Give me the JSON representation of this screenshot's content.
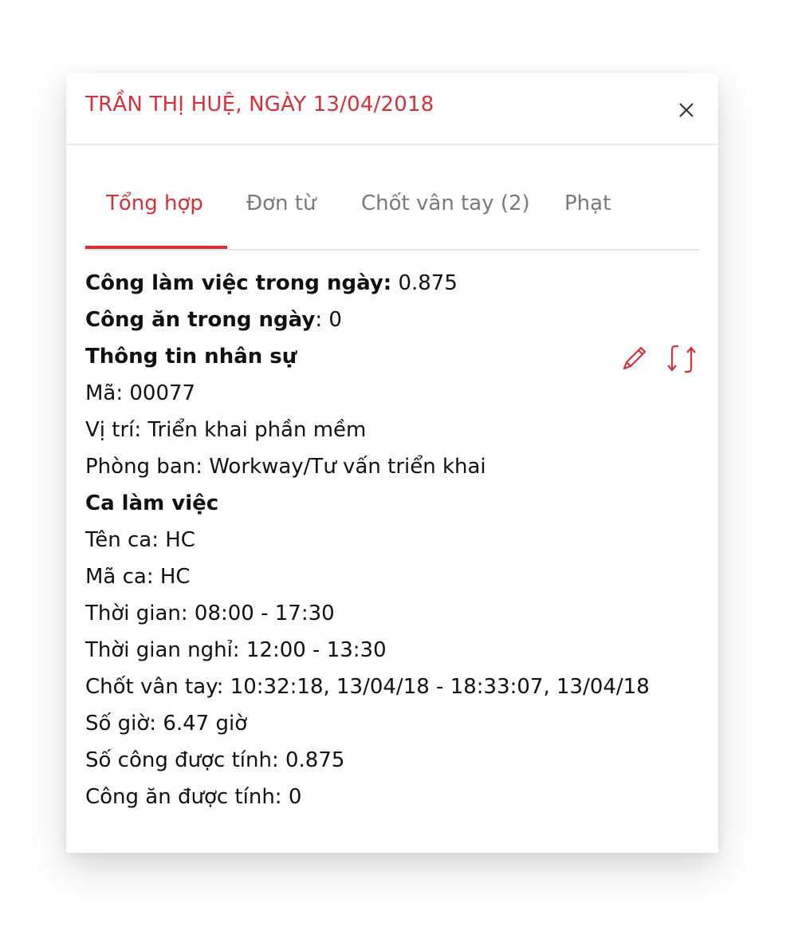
{
  "modal": {
    "title": "TRẦN THỊ HUỆ, NGÀY 13/04/2018"
  },
  "tabs": [
    {
      "label": "Tổng hợp",
      "active": true
    },
    {
      "label": "Đơn từ",
      "active": false
    },
    {
      "label": "Chốt vân tay (2)",
      "active": false
    },
    {
      "label": "Phạt",
      "active": false
    }
  ],
  "summary": {
    "work_label": "Công làm việc trong ngày:",
    "work_value": " 0.875",
    "meal_label": "Công ăn trong ngày",
    "meal_value": ": 0"
  },
  "employee": {
    "heading": "Thông tin nhân sự",
    "code": "Mã: 00077",
    "position": "Vị trí: Triển khai phần mềm",
    "department": "Phòng ban: Workway/Tư vấn triển khai"
  },
  "shift": {
    "heading": "Ca làm việc",
    "name": "Tên ca: HC",
    "code": "Mã ca: HC",
    "time": "Thời gian: 08:00 - 17:30",
    "break_time": "Thời gian nghỉ: 12:00 - 13:30",
    "fingerprint": "Chốt vân tay: 10:32:18, 13/04/18 - 18:33:07, 13/04/18",
    "hours": "Số giờ: 6.47 giờ",
    "counted_work": "Số công được tính: 0.875",
    "counted_meal": "Công ăn được tính: 0"
  },
  "icons": {
    "close": "close-icon",
    "edit": "pencil-icon",
    "refresh": "swap-refresh-icon"
  },
  "colors": {
    "accent": "#d0333a",
    "text": "#111111",
    "muted": "#7a7a7a"
  }
}
